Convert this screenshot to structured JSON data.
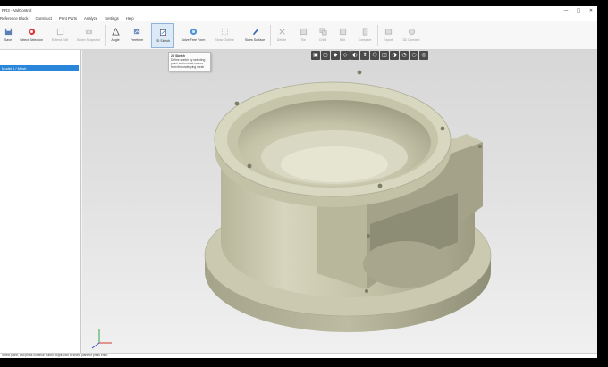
{
  "window": {
    "title": "PR3 - ValControl",
    "controls": [
      "—",
      "□",
      "✕"
    ]
  },
  "menu": [
    "Reference Block",
    "Construct",
    "Print Parts",
    "Analyze",
    "Settings",
    "Help"
  ],
  "ribbon": {
    "buttons": [
      {
        "label": "Save",
        "icon": "save-icon"
      },
      {
        "label": "Select Selection",
        "icon": "selection-icon"
      },
      {
        "label": "Extend Edit",
        "icon": "extend-icon",
        "disabled": true
      },
      {
        "label": "Beam Snapshot",
        "icon": "camera-icon",
        "disabled": true
      },
      {
        "label": "Angle",
        "icon": "angle-icon"
      },
      {
        "label": "Freeform",
        "icon": "freeform-icon"
      },
      {
        "label": "2D Sketch",
        "icon": "sketch-icon",
        "active": true
      },
      {
        "label": "Solve Free Form",
        "icon": "solve-icon"
      },
      {
        "label": "Show Outline",
        "icon": "outline-icon",
        "disabled": true
      },
      {
        "label": "Sides Surface",
        "icon": "surface-icon"
      },
      {
        "label": "Delete",
        "icon": "delete-icon",
        "disabled": true
      },
      {
        "label": "Tile",
        "icon": "tile-icon",
        "disabled": true
      },
      {
        "label": "Child",
        "icon": "child-icon",
        "disabled": true
      },
      {
        "label": "Edit",
        "icon": "edit-icon",
        "disabled": true
      },
      {
        "label": "Compare",
        "icon": "compare-icon",
        "disabled": true
      },
      {
        "label": "Export",
        "icon": "export-icon",
        "disabled": true
      },
      {
        "label": "3D Connect",
        "icon": "connect-icon",
        "disabled": true
      }
    ]
  },
  "tooltip": {
    "title": "2D Sketch",
    "text": "Define sketch by selecting plane and extract curves from the underlying mesh"
  },
  "tree": {
    "selected": "Model 1 / Mesh"
  },
  "viewport_toolbar": [
    "▣",
    "▢",
    "◆",
    "◇",
    "◐",
    "↕",
    "⬡",
    "◫",
    "◑",
    "◔",
    "○",
    "◎"
  ],
  "status_text": "Select plane, and press continue button. Right-click to select plane or press enter.",
  "colors": {
    "accent": "#2a86d8",
    "part": "#c7c6aa"
  }
}
